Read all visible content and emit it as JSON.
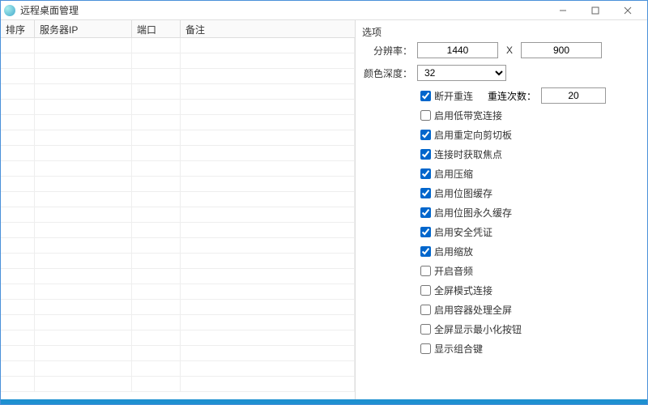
{
  "window": {
    "title": "远程桌面管理"
  },
  "table": {
    "columns": [
      "排序",
      "服务器IP",
      "端口",
      "备注"
    ]
  },
  "options": {
    "group_label": "选项",
    "resolution_label": "分辨率：",
    "resolution_width": "1440",
    "resolution_sep": "X",
    "resolution_height": "900",
    "color_depth_label": "颜色深度：",
    "color_depth_value": "32",
    "disconnect_reconnect": {
      "checked": true,
      "label": "断开重连"
    },
    "reconnect_count_label": "重连次数：",
    "reconnect_count_value": "20",
    "checkboxes": [
      {
        "checked": false,
        "label": "启用低带宽连接"
      },
      {
        "checked": true,
        "label": "启用重定向剪切板"
      },
      {
        "checked": true,
        "label": "连接时获取焦点"
      },
      {
        "checked": true,
        "label": "启用压缩"
      },
      {
        "checked": true,
        "label": "启用位图缓存"
      },
      {
        "checked": true,
        "label": "启用位图永久缓存"
      },
      {
        "checked": true,
        "label": "启用安全凭证"
      },
      {
        "checked": true,
        "label": "启用缩放"
      },
      {
        "checked": false,
        "label": "开启音频"
      },
      {
        "checked": false,
        "label": "全屏模式连接"
      },
      {
        "checked": false,
        "label": "启用容器处理全屏"
      },
      {
        "checked": false,
        "label": "全屏显示最小化按钮"
      },
      {
        "checked": false,
        "label": "显示组合键"
      }
    ]
  }
}
